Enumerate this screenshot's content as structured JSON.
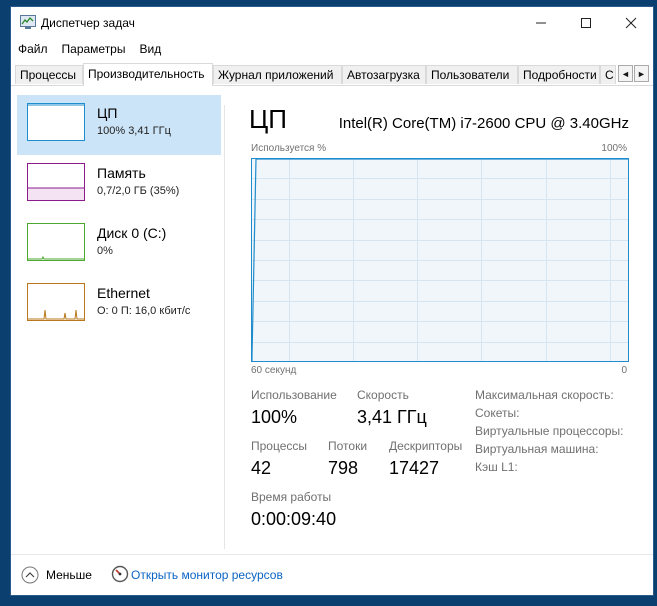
{
  "window": {
    "title": "Диспетчер задач"
  },
  "menu": [
    "Файл",
    "Параметры",
    "Вид"
  ],
  "tabs": [
    "Процессы",
    "Производительность",
    "Журнал приложений",
    "Автозагрузка",
    "Пользователи",
    "Подробности",
    "С"
  ],
  "active_tab": "Производительность",
  "sidebar": [
    {
      "title": "ЦП",
      "sub": "100% 3,41 ГГц",
      "color": "#1f8ccc"
    },
    {
      "title": "Память",
      "sub": "0,7/2,0 ГБ (35%)",
      "color": "#8b1a8b"
    },
    {
      "title": "Диск 0 (C:)",
      "sub": "0%",
      "color": "#4da830"
    },
    {
      "title": "Ethernet",
      "sub": "О: 0 П: 16,0 кбит/с",
      "color": "#b8771a"
    }
  ],
  "main": {
    "title": "ЦП",
    "cpu_name": "Intel(R) Core(TM) i7-2600 CPU @ 3.40GHz",
    "graph": {
      "y_label": "Используется %",
      "y_max_label": "100%",
      "x_label": "60 секунд",
      "x_min_label": "0",
      "usage_value": 100
    },
    "stats": {
      "usage_label": "Использование",
      "usage_value": "100%",
      "speed_label": "Скорость",
      "speed_value": "3,41 ГГц",
      "processes_label": "Процессы",
      "processes_value": "42",
      "threads_label": "Потоки",
      "threads_value": "798",
      "handles_label": "Дескрипторы",
      "handles_value": "17427",
      "uptime_label": "Время работы",
      "uptime_value": "0:00:09:40"
    },
    "specs": {
      "max_speed": "Максимальная скорость:",
      "sockets": "Сокеты:",
      "virtual_processors": "Виртуальные процессоры:",
      "virtual_machine": "Виртуальная машина:",
      "l1_cache": "Кэш L1:"
    }
  },
  "footer": {
    "fewer": "Меньше",
    "open_monitor": "Открыть монитор ресурсов"
  }
}
